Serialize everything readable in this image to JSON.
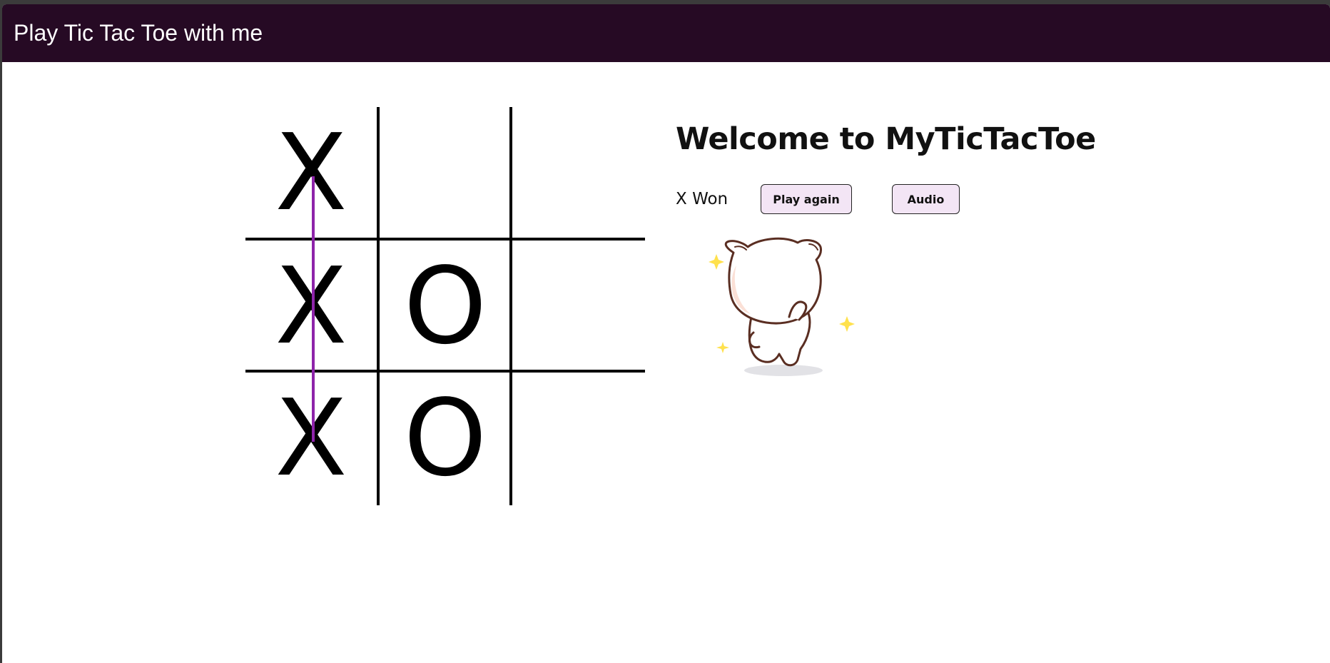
{
  "window": {
    "title": "Play Tic Tac Toe with me"
  },
  "board": {
    "cells": [
      "X",
      "",
      "",
      "X",
      "O",
      "",
      "X",
      "O",
      ""
    ],
    "winning_line": "left-column"
  },
  "panel": {
    "heading": "Welcome to MyTicTacToe",
    "status": "X Won",
    "play_again_label": "Play again",
    "audio_label": "Audio"
  },
  "colors": {
    "titlebar": "#260a24",
    "win_line": "#8e24aa",
    "button_bg": "#f3e5f5",
    "sparkle": "#ffe14d"
  },
  "illustration": {
    "icon": "dancing-cat-icon"
  }
}
